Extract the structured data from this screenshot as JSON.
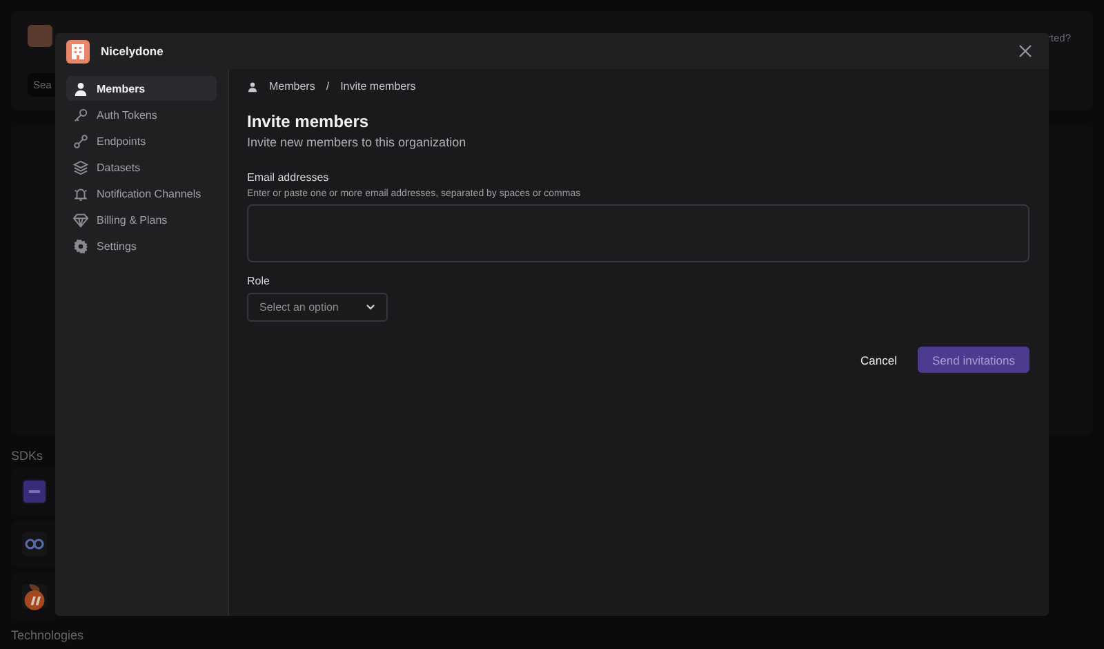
{
  "background": {
    "search": {
      "placeholder": "Sea"
    },
    "help_text": "rted?",
    "sdks_heading": "SDKs",
    "technologies_heading": "Technologies"
  },
  "modal": {
    "org_name": "Nicelydone",
    "sidebar": {
      "items": [
        {
          "label": "Members",
          "selected": true
        },
        {
          "label": "Auth Tokens",
          "selected": false
        },
        {
          "label": "Endpoints",
          "selected": false
        },
        {
          "label": "Datasets",
          "selected": false
        },
        {
          "label": "Notification Channels",
          "selected": false
        },
        {
          "label": "Billing & Plans",
          "selected": false
        },
        {
          "label": "Settings",
          "selected": false
        }
      ]
    },
    "breadcrumb": [
      "Members",
      "Invite members"
    ],
    "breadcrumb_separator": "/",
    "title": "Invite members",
    "subtitle": "Invite new members to this organization",
    "email": {
      "label": "Email addresses",
      "hint": "Enter or paste one or more email addresses, separated by spaces or commas"
    },
    "role": {
      "label": "Role",
      "placeholder": "Select an option"
    },
    "buttons": {
      "cancel": "Cancel",
      "submit": "Send invitations"
    }
  }
}
